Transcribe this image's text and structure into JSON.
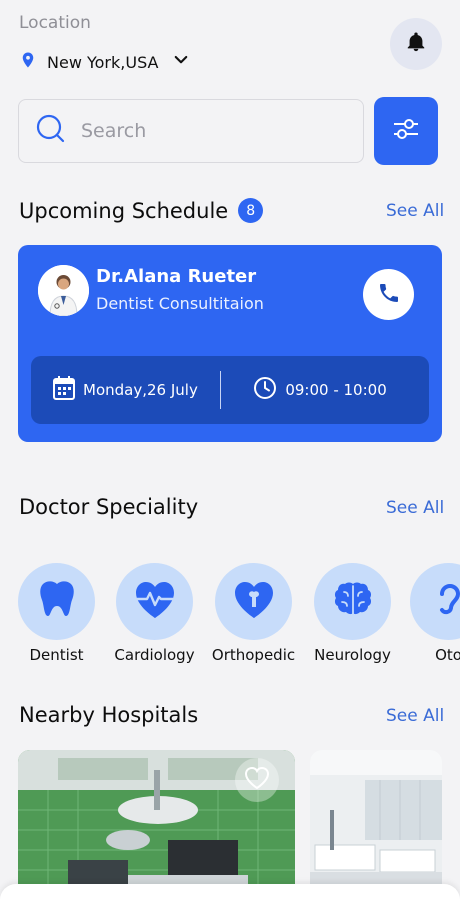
{
  "location": {
    "label": "Location",
    "city": "New York,USA"
  },
  "search": {
    "placeholder": "Search"
  },
  "schedule": {
    "title": "Upcoming Schedule",
    "count": "8",
    "see_all": "See All",
    "doctor_name": "Dr.Alana Rueter",
    "doctor_role": "Dentist Consultitaion",
    "date": "Monday,26 July",
    "time": "09:00 - 10:00"
  },
  "speciality": {
    "title": "Doctor Speciality",
    "see_all": "See All",
    "items": [
      {
        "label": "Dentist",
        "icon": "tooth-icon"
      },
      {
        "label": "Cardiology",
        "icon": "heart-pulse-icon"
      },
      {
        "label": "Orthopedic",
        "icon": "bone-heart-icon"
      },
      {
        "label": "Neurology",
        "icon": "brain-icon"
      },
      {
        "label": "Oto",
        "icon": "ear-icon"
      }
    ]
  },
  "hospitals": {
    "title": "Nearby Hospitals",
    "see_all": "See All"
  },
  "colors": {
    "primary": "#2e66f2",
    "primary_dark": "#1c4bb8",
    "specialty_bg": "#c7dcfa",
    "background": "#f3f3f5"
  }
}
